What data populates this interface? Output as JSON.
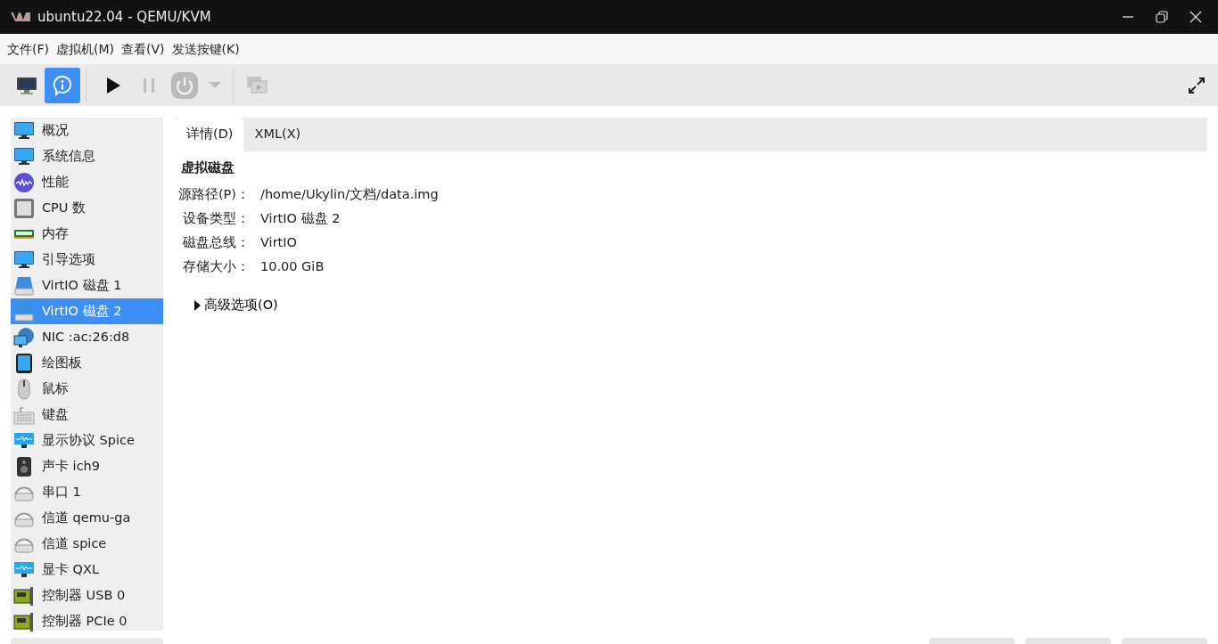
{
  "window": {
    "title": "ubuntu22.04 - QEMU/KVM"
  },
  "menu": [
    "文件(F)",
    "虚拟机(M)",
    "查看(V)",
    "发送按键(K)"
  ],
  "toolbar": [
    {
      "kind": "console",
      "selected": false,
      "disabled": false
    },
    {
      "kind": "details",
      "selected": true,
      "disabled": false
    },
    {
      "kind": "run",
      "selected": false,
      "disabled": false
    },
    {
      "kind": "pause",
      "selected": false,
      "disabled": true
    },
    {
      "kind": "shutdown",
      "selected": false,
      "disabled": true
    },
    {
      "kind": "dropdown",
      "selected": false,
      "disabled": true
    },
    {
      "kind": "snapshots",
      "selected": false,
      "disabled": true
    }
  ],
  "sidebar": {
    "items": [
      {
        "label": "概况",
        "kind": "monitor",
        "selected": false
      },
      {
        "label": "系统信息",
        "kind": "monitor",
        "selected": false
      },
      {
        "label": "性能",
        "kind": "performance",
        "selected": false
      },
      {
        "label": "CPU 数",
        "kind": "cpu",
        "selected": false
      },
      {
        "label": "内存",
        "kind": "memory",
        "selected": false
      },
      {
        "label": "引导选项",
        "kind": "monitor",
        "selected": false
      },
      {
        "label": "VirtIO 磁盘 1",
        "kind": "disk",
        "selected": false
      },
      {
        "label": "VirtIO 磁盘 2",
        "kind": "disk",
        "selected": true
      },
      {
        "label": "NIC :ac:26:d8",
        "kind": "nic",
        "selected": false
      },
      {
        "label": "绘图板",
        "kind": "tablet",
        "selected": false
      },
      {
        "label": "鼠标",
        "kind": "mouse",
        "selected": false
      },
      {
        "label": "键盘",
        "kind": "keyboard",
        "selected": false
      },
      {
        "label": "显示协议 Spice",
        "kind": "display",
        "selected": false
      },
      {
        "label": "声卡 ich9",
        "kind": "speaker",
        "selected": false
      },
      {
        "label": "串口 1",
        "kind": "serial",
        "selected": false
      },
      {
        "label": "信道 qemu-ga",
        "kind": "serial",
        "selected": false
      },
      {
        "label": "信道 spice",
        "kind": "serial",
        "selected": false
      },
      {
        "label": "显卡 QXL",
        "kind": "display",
        "selected": false
      },
      {
        "label": "控制器 USB 0",
        "kind": "controller",
        "selected": false
      },
      {
        "label": "控制器 PCIe 0",
        "kind": "controller",
        "selected": false
      }
    ]
  },
  "tabs": [
    {
      "label": "详情(D)",
      "selected": true
    },
    {
      "label": "XML(X)",
      "selected": false
    }
  ],
  "details": {
    "heading": "虚拟磁盘",
    "fields": [
      {
        "label": "源路径(P)：",
        "value": "/home/Ukylin/文档/data.img"
      },
      {
        "label": "设备类型：",
        "value": "VirtIO 磁盘 2"
      },
      {
        "label": "磁盘总线：",
        "value": "VirtIO"
      },
      {
        "label": "存储大小：",
        "value": "10.00 GiB"
      }
    ],
    "expander": {
      "label": "高级选项(O)",
      "expanded": false
    }
  }
}
